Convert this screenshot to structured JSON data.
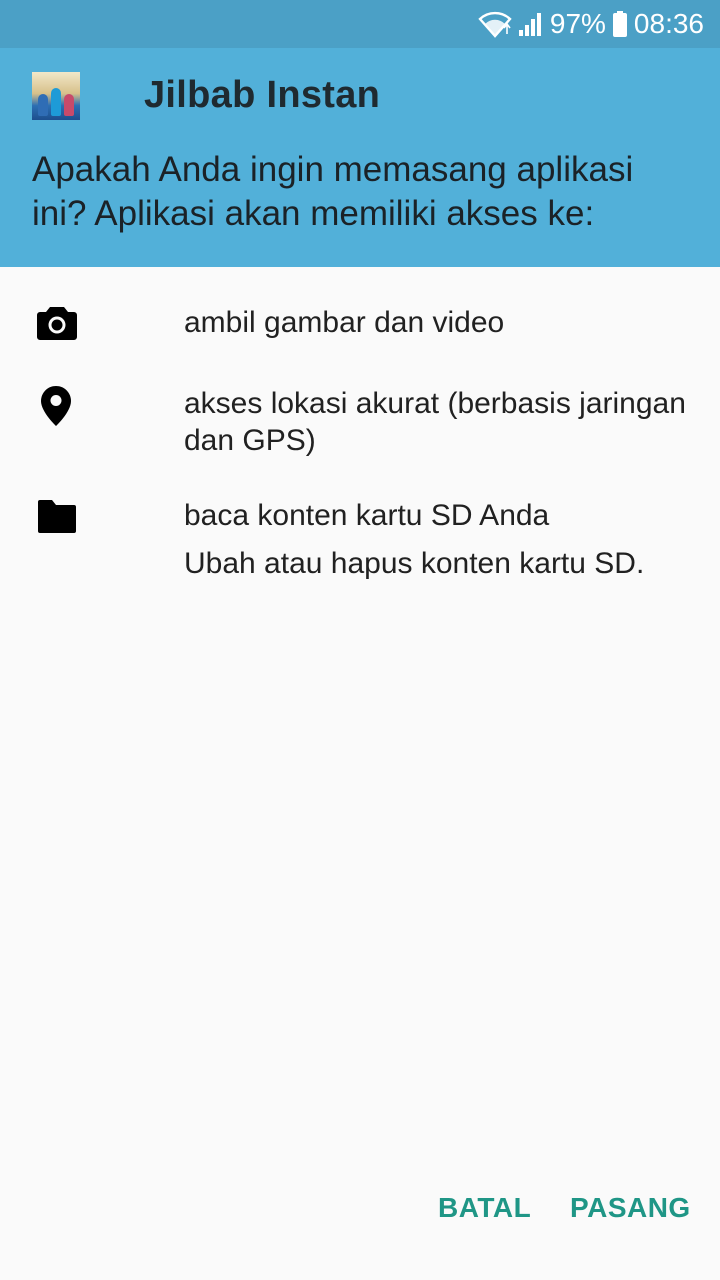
{
  "status_bar": {
    "battery_percent": "97%",
    "time": "08:36",
    "icons": [
      "wifi-icon",
      "signal-icon",
      "battery-icon"
    ]
  },
  "header": {
    "app_name": "Jilbab Instan",
    "prompt": "Apakah Anda ingin memasang aplikasi ini? Aplikasi akan memiliki akses ke:"
  },
  "permissions": [
    {
      "icon": "camera-icon",
      "label": "ambil gambar dan video"
    },
    {
      "icon": "location-pin-icon",
      "label": "akses lokasi akurat (berbasis jaringan dan GPS)"
    },
    {
      "icon": "folder-icon",
      "label": "baca konten kartu SD Anda",
      "sub_label": "Ubah atau hapus konten kartu SD."
    }
  ],
  "actions": {
    "cancel_label": "BATAL",
    "install_label": "PASANG"
  },
  "colors": {
    "status_bar": "#4ba0c6",
    "header": "#52b0d9",
    "background": "#fafafa",
    "accent_button": "#1f9686"
  }
}
